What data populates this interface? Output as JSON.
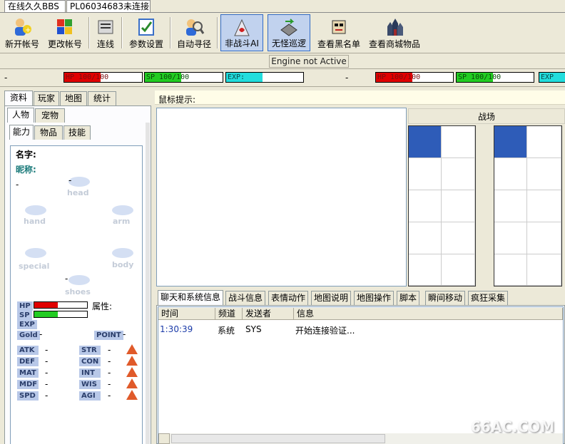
{
  "title_tabs": [
    "在线久久BBS",
    "PL06034683未连接"
  ],
  "toolbar": {
    "buttons": [
      {
        "label": "新开帐号",
        "icon": "new-account-icon"
      },
      {
        "label": "更改帐号",
        "icon": "change-account-icon"
      },
      {
        "label": "连线",
        "icon": "connect-icon"
      },
      {
        "label": "参数设置",
        "icon": "settings-icon"
      },
      {
        "label": "自动寻径",
        "icon": "auto-path-icon"
      },
      {
        "label": "非战斗AI",
        "icon": "non-combat-ai-icon"
      },
      {
        "label": "无怪巡逻",
        "icon": "patrol-icon"
      },
      {
        "label": "查看黑名单",
        "icon": "blacklist-icon"
      },
      {
        "label": "查看商城物品",
        "icon": "shop-icon"
      }
    ]
  },
  "status": "Engine not Active",
  "bars_left": {
    "dash": "-",
    "hp": {
      "text": "HP  100/100",
      "ratio": 0.47
    },
    "sp": {
      "text": "SP  100/100",
      "ratio": 0.47
    },
    "exp": {
      "text": "EXP:",
      "ratio": 0.47
    }
  },
  "bars_right": {
    "dash": "-",
    "hp": {
      "text": "HP  100/100",
      "ratio": 0.47
    },
    "sp": {
      "text": "SP  100/100",
      "ratio": 0.47
    },
    "exp": {
      "text": "EXP"
    }
  },
  "colors": {
    "hp": "#e00000",
    "sp": "#22cc22",
    "exp": "#22dddd",
    "grid_active": "#2e5cb8"
  },
  "left_tabs": [
    "资料",
    "玩家",
    "地图",
    "统计"
  ],
  "sub_tabs": [
    "人物",
    "宠物"
  ],
  "sub_tabs2": [
    "能力",
    "物品",
    "技能"
  ],
  "character": {
    "name_label": "名字:",
    "nick_label": "昵称:",
    "dash": "-",
    "slots": {
      "head": "head",
      "hand": "hand",
      "arm": "arm",
      "special": "special",
      "body": "body",
      "shoes": "shoes"
    },
    "hp_label": "HP",
    "sp_label": "SP",
    "exp_label": "EXP",
    "gold_label": "Gold",
    "point_label": "POINT",
    "attr_label": "属性:",
    "hp_ratio": 0.45,
    "sp_ratio": 0.45,
    "stats_left": [
      "ATK",
      "DEF",
      "MAT",
      "MDF",
      "SPD"
    ],
    "stats_right": [
      "STR",
      "CON",
      "INT",
      "WIS",
      "AGI"
    ],
    "stat_value": "-"
  },
  "mouse_hint": "鼠标提示:",
  "battlefield": "战场",
  "chat_tabs": [
    "聊天和系统信息",
    "战斗信息",
    "表情动作",
    "地图说明",
    "地图操作",
    "脚本",
    "瞬间移动",
    "疯狂采集"
  ],
  "chat_columns": [
    "时间",
    "频道",
    "发送者",
    "信息"
  ],
  "chat_rows": [
    {
      "time": "1:30:39",
      "channel": "系统",
      "sender": "SYS",
      "message": "开始连接验证..."
    }
  ],
  "watermark": "66AC.COM"
}
